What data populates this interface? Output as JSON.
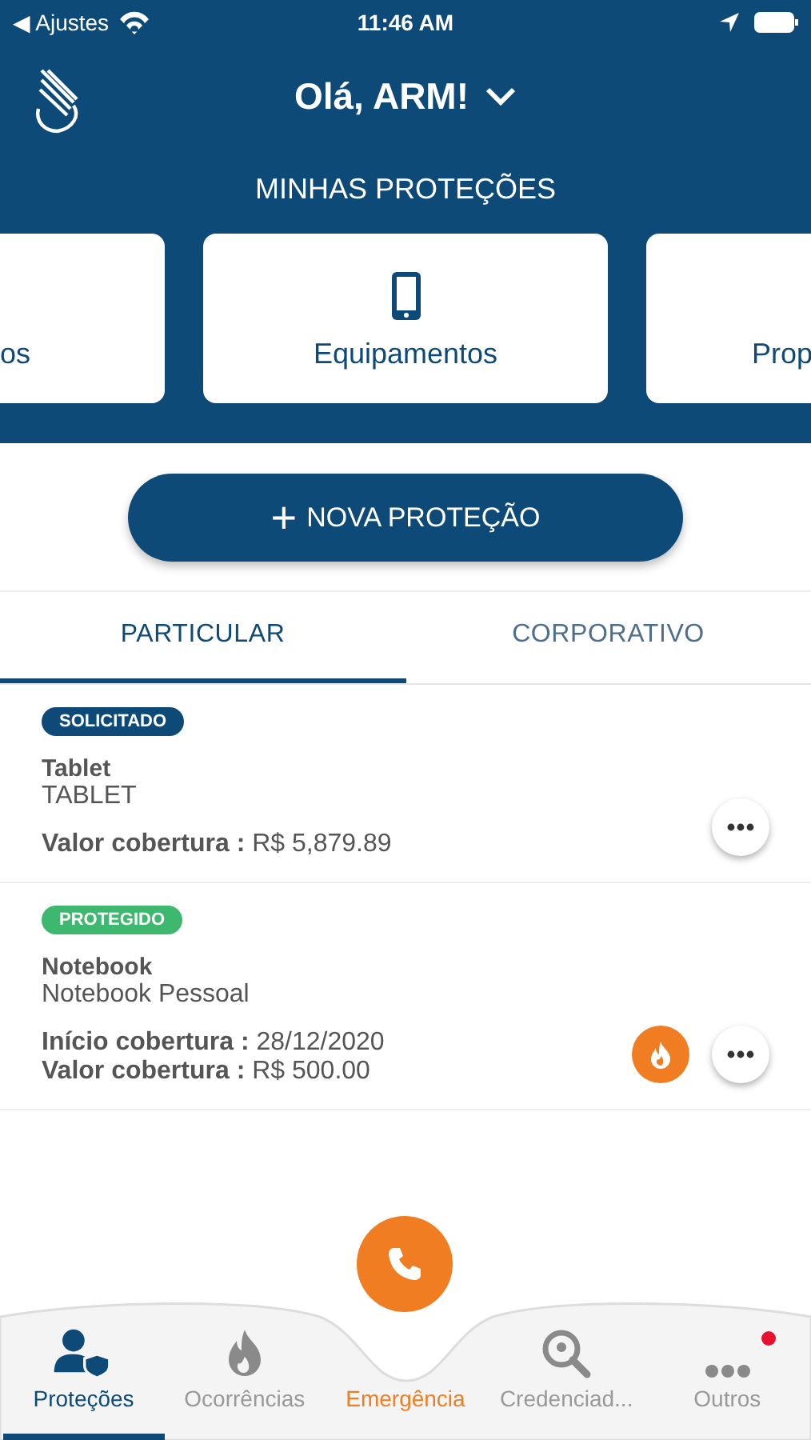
{
  "status_bar": {
    "back": "◀ Ajustes",
    "time": "11:46 AM"
  },
  "header": {
    "greeting": "Olá, ARM!"
  },
  "section_title": "MINHAS PROTEÇÕES",
  "categories": [
    {
      "label": "os",
      "kind": "clipped_left"
    },
    {
      "label": "Equipamentos",
      "kind": "full"
    },
    {
      "label": "Prop",
      "kind": "clipped_right"
    }
  ],
  "new_button": {
    "icon": "+",
    "label": "NOVA PROTEÇÃO"
  },
  "tabs": [
    {
      "label": "PARTICULAR",
      "selected": true
    },
    {
      "label": "CORPORATIVO",
      "selected": false
    }
  ],
  "protections": [
    {
      "status": "SOLICITADO",
      "color": "#0d4a78",
      "title": "Tablet",
      "subtitle": "TABLET",
      "fields": [
        {
          "label": "Valor cobertura :",
          "value": "R$ 5,879.89"
        }
      ],
      "claim_action": false
    },
    {
      "status": "PROTEGIDO",
      "color": "#3fb86f",
      "title": "Notebook",
      "subtitle": "Notebook Pessoal",
      "fields": [
        {
          "label": "Início cobertura :",
          "value": "28/12/2020"
        },
        {
          "label": "Valor cobertura :",
          "value": "R$ 500.00"
        }
      ],
      "claim_action": true
    }
  ],
  "nav": [
    {
      "label": "Proteções",
      "kind": "person",
      "selected": true,
      "badge": false
    },
    {
      "label": "Ocorrências",
      "kind": "fire",
      "selected": false,
      "badge": false
    },
    {
      "label": "Emergência",
      "kind": "phone",
      "selected": false,
      "badge": false
    },
    {
      "label": "Credenciad...",
      "kind": "search",
      "selected": false,
      "badge": false
    },
    {
      "label": "Outros",
      "kind": "more",
      "selected": false,
      "badge": true
    }
  ]
}
